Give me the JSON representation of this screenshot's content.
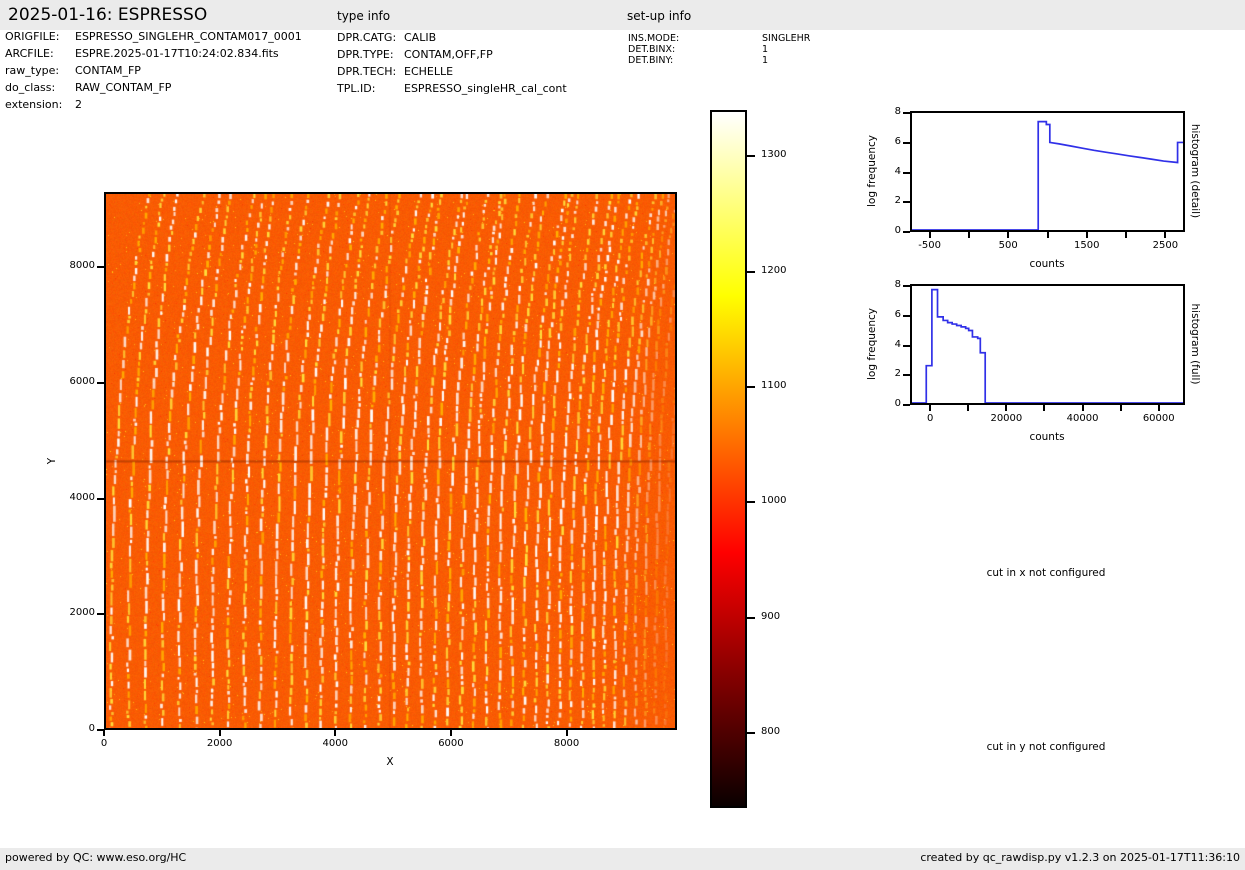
{
  "page": {
    "bg": "#ffffff",
    "band_color": "#ebebeb",
    "text_color": "#000000"
  },
  "header": {
    "title": "2025-01-16: ESPRESSO",
    "type_info_label": "type info",
    "setup_info_label": "set-up info"
  },
  "file_info": {
    "rows": [
      {
        "label": "ORIGFILE:",
        "value": "ESPRESSO_SINGLEHR_CONTAM017_0001"
      },
      {
        "label": "ARCFILE:",
        "value": "ESPRE.2025-01-17T10:24:02.834.fits"
      },
      {
        "label": "raw_type:",
        "value": "CONTAM_FP"
      },
      {
        "label": "do_class:",
        "value": "RAW_CONTAM_FP"
      },
      {
        "label": "extension:",
        "value": "2"
      }
    ]
  },
  "type_info": {
    "rows": [
      {
        "label": "DPR.CATG:",
        "value": "CALIB"
      },
      {
        "label": "DPR.TYPE:",
        "value": "CONTAM,OFF,FP"
      },
      {
        "label": "DPR.TECH:",
        "value": "ECHELLE"
      },
      {
        "label": "TPL.ID:",
        "value": "ESPRESSO_singleHR_cal_cont"
      }
    ]
  },
  "setup_info": {
    "rows": [
      {
        "label": "INS.MODE:",
        "value": "SINGLEHR"
      },
      {
        "label": "DET.BINX:",
        "value": "1"
      },
      {
        "label": "DET.BINY:",
        "value": "1"
      }
    ]
  },
  "messages": {
    "cut_x": "cut in x not configured",
    "cut_y": "cut in y not configured"
  },
  "footer": {
    "left": "powered by QC: www.eso.org/HC",
    "right": "created by qc_rawdisp.py v1.2.3 on 2025-01-17T11:36:10"
  },
  "chart_data": [
    {
      "type": "heatmap",
      "name": "raw-frame-display",
      "description": "ESPRESSO raw FP contamination frame: ~43 slightly curved dashed echelle order traces (white/yellow) on orange background of ~1050 counts; traces tilt right toward the top, fade near right edge; horizontal detector seam at Y≈4670.",
      "xlabel": "X",
      "ylabel": "Y",
      "xlim": [
        0,
        9910
      ],
      "ylim": [
        0,
        9300
      ],
      "xticks": [
        0,
        2000,
        4000,
        6000,
        8000
      ],
      "yticks": [
        0,
        2000,
        4000,
        6000,
        8000
      ],
      "background_color": "#f85c01",
      "colorbar": {
        "colormap": "hot",
        "vmin": 735,
        "vmax": 1340,
        "ticks": [
          800,
          900,
          1000,
          1100,
          1200,
          1300
        ],
        "gradient": [
          [
            "#0a0000",
            0
          ],
          [
            "#800000",
            0.18
          ],
          [
            "#ff0000",
            0.365
          ],
          [
            "#ff8000",
            0.55
          ],
          [
            "#ffff00",
            0.735
          ],
          [
            "#ffff80",
            0.87
          ],
          [
            "#ffffff",
            1
          ]
        ]
      }
    },
    {
      "type": "line",
      "name": "histogram-detail",
      "right_label": "histogram (detail)",
      "xlabel": "counts",
      "ylabel": "log frequency",
      "xlim": [
        -750,
        2750
      ],
      "ylim": [
        0,
        8.15
      ],
      "xticks_major": [
        -500,
        500,
        1500,
        2500
      ],
      "xticks_minor": [
        0,
        1000,
        2000
      ],
      "yticks": [
        0,
        2,
        4,
        6,
        8
      ],
      "line_color": "#3030e8",
      "steps": [
        [
          -750,
          0
        ],
        [
          880,
          0
        ],
        [
          880,
          7.55
        ],
        [
          985,
          7.55
        ],
        [
          985,
          7.35
        ],
        [
          1030,
          7.35
        ],
        [
          1030,
          6.1
        ],
        [
          1150,
          6.0
        ],
        [
          1300,
          5.85
        ],
        [
          1450,
          5.7
        ],
        [
          1600,
          5.55
        ],
        [
          1750,
          5.42
        ],
        [
          1900,
          5.3
        ],
        [
          2050,
          5.17
        ],
        [
          2200,
          5.05
        ],
        [
          2350,
          4.93
        ],
        [
          2500,
          4.8
        ],
        [
          2680,
          4.7
        ],
        [
          2680,
          6.1
        ],
        [
          2750,
          6.1
        ]
      ]
    },
    {
      "type": "line",
      "name": "histogram-full",
      "right_label": "histogram (full)",
      "xlabel": "counts",
      "ylabel": "log frequency",
      "xlim": [
        -5300,
        66900
      ],
      "ylim": [
        0,
        8.15
      ],
      "xticks_major": [
        0,
        20000,
        40000,
        60000
      ],
      "xticks_minor": [
        10000,
        30000,
        50000
      ],
      "yticks": [
        0,
        2,
        4,
        6,
        8
      ],
      "line_color": "#3030e8",
      "steps": [
        [
          -5300,
          0
        ],
        [
          -1500,
          0
        ],
        [
          -1500,
          2.6
        ],
        [
          0,
          2.6
        ],
        [
          0,
          7.9
        ],
        [
          1500,
          7.9
        ],
        [
          1500,
          6.0
        ],
        [
          3000,
          6.0
        ],
        [
          3000,
          5.75
        ],
        [
          4200,
          5.75
        ],
        [
          4200,
          5.6
        ],
        [
          5400,
          5.6
        ],
        [
          5400,
          5.5
        ],
        [
          6600,
          5.5
        ],
        [
          6600,
          5.4
        ],
        [
          7800,
          5.4
        ],
        [
          7800,
          5.3
        ],
        [
          9000,
          5.3
        ],
        [
          9000,
          5.2
        ],
        [
          9800,
          5.2
        ],
        [
          9800,
          5.05
        ],
        [
          10800,
          5.05
        ],
        [
          10800,
          4.6
        ],
        [
          12200,
          4.6
        ],
        [
          12200,
          4.5
        ],
        [
          12900,
          4.5
        ],
        [
          12900,
          3.5
        ],
        [
          14200,
          3.5
        ],
        [
          14200,
          0
        ],
        [
          66900,
          0
        ]
      ]
    }
  ]
}
